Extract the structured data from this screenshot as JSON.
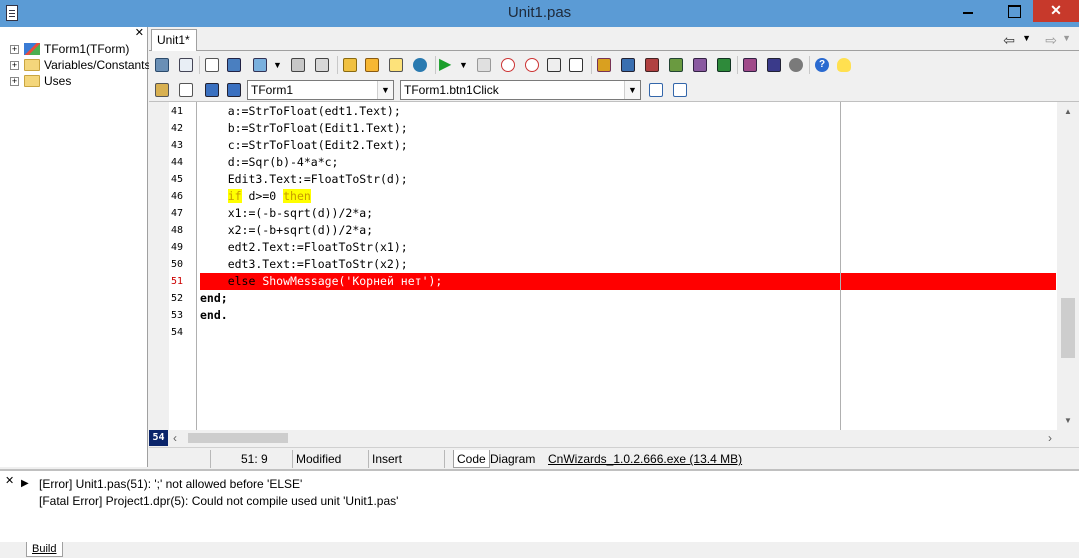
{
  "window": {
    "title": "Unit1.pas"
  },
  "structure_tree": [
    {
      "label": "TForm1(TForm)",
      "icon": "form-icon"
    },
    {
      "label": "Variables/Constants",
      "icon": "folder-icon"
    },
    {
      "label": "Uses",
      "icon": "folder-icon"
    }
  ],
  "tabs": {
    "active": "Unit1*"
  },
  "combos": {
    "class_combo": "TForm1",
    "method_combo": "TForm1.btn1Click"
  },
  "editor": {
    "lines": [
      {
        "num": "41",
        "text": "    a:=StrToFloat(edt1.Text);"
      },
      {
        "num": "42",
        "text": "    b:=StrToFloat(Edit1.Text);"
      },
      {
        "num": "43",
        "text": "    c:=StrToFloat(Edit2.Text);"
      },
      {
        "num": "44",
        "text": "    d:=Sqr(b)-4*a*c;"
      },
      {
        "num": "45",
        "text": "    Edit3.Text:=FloatToStr(d);"
      },
      {
        "num": "46",
        "kw1": "if",
        "mid": " d>=0 ",
        "kw2": "then"
      },
      {
        "num": "47",
        "text": "    x1:=(-b-sqrt(d))/2*a;"
      },
      {
        "num": "48",
        "text": "    x2:=(-b+sqrt(d))/2*a;"
      },
      {
        "num": "49",
        "text": "    edt2.Text:=FloatToStr(x1);"
      },
      {
        "num": "50",
        "text": "    edt3.Text:=FloatToStr(x2);"
      },
      {
        "num": "51",
        "kw": "else",
        "rest": " ShowMessage('Корней нет');"
      },
      {
        "num": "52",
        "text": "end;"
      },
      {
        "num": "53",
        "text": "end."
      },
      {
        "num": "54",
        "text": ""
      }
    ],
    "current_line": "54"
  },
  "status": {
    "position": "51:  9",
    "modified": "Modified",
    "insert_mode": "Insert",
    "tab_code": "Code",
    "tab_diagram": "Diagram",
    "wizard": "CnWizards_1.0.2.666.exe (13.4 MB)"
  },
  "messages": [
    "[Error] Unit1.pas(51): ';' not allowed before 'ELSE'",
    "[Fatal Error] Project1.dpr(5): Could not compile used unit 'Unit1.pas'"
  ],
  "bottom_tab": "Build",
  "colors": {
    "error_line": "#ff0000",
    "highlight_keyword": "#ffff00",
    "titlebar": "#5b9bd5"
  }
}
